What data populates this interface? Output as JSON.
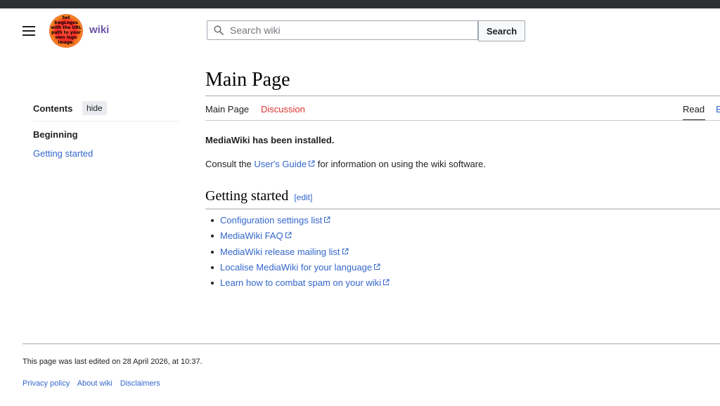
{
  "header": {
    "logo_text": "Set $wgLogos with the URL path to your own logo image.",
    "wordmark": "wiki",
    "search": {
      "placeholder": "Search wiki",
      "value": "",
      "button_label": "Search"
    }
  },
  "toc": {
    "title": "Contents",
    "hide_label": "hide",
    "items": [
      {
        "label": "Beginning"
      },
      {
        "label": "Getting started"
      }
    ]
  },
  "page": {
    "title": "Main Page",
    "tabs": {
      "main_page": "Main Page",
      "discussion": "Discussion",
      "read": "Read",
      "edit": "E"
    },
    "installed": "MediaWiki has been installed.",
    "consult_before": "Consult the ",
    "consult_link": "User's Guide",
    "consult_after": " for information on using the wiki software.",
    "section": {
      "title": "Getting started",
      "edit_label": "[edit]",
      "links": [
        "Configuration settings list",
        "MediaWiki FAQ",
        "MediaWiki release mailing list",
        "Localise MediaWiki for your language",
        "Learn how to combat spam on your wiki"
      ]
    }
  },
  "footer": {
    "last_edited": "This page was last edited on 28 April 2026, at 10:37.",
    "links": [
      "Privacy policy",
      "About wiki",
      "Disclaimers"
    ]
  },
  "colors": {
    "link": "#3366cc",
    "discussion_tab": "#d33",
    "wordmark": "#6a52a8"
  }
}
